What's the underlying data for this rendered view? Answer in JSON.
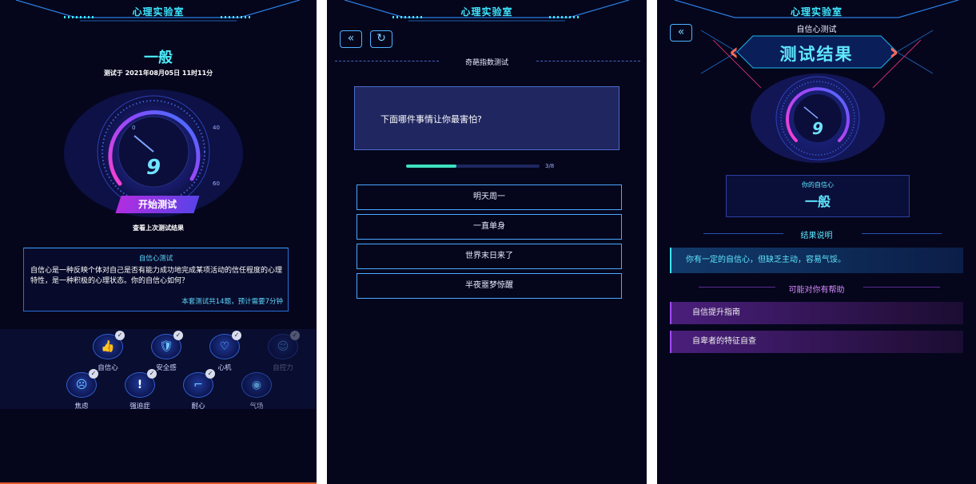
{
  "header": {
    "title": "心理实验室"
  },
  "home": {
    "level": "一般",
    "test_time": "测试于 2021年08月05日 11时11分",
    "gauge_value": "9",
    "start_button": "开始测试",
    "view_last": "查看上次测试结果",
    "desc_title": "自信心测试",
    "desc_text": "自信心是一种反映个体对自己是否有能力成功地完成某项活动的信任程度的心理特性，是一种积极的心理状态。你的自信心如何？",
    "desc_meta": "本套测试共14题，预计需要7分钟",
    "categories_row1": [
      {
        "label": "自信心",
        "icon": "thumbs-up-icon",
        "glyph": "👍",
        "checked": true
      },
      {
        "label": "安全感",
        "icon": "shield-icon",
        "glyph": "🛡",
        "checked": true
      },
      {
        "label": "心机",
        "icon": "heart-pulse-icon",
        "glyph": "♡",
        "checked": true
      },
      {
        "label": "自控力",
        "icon": "face-icon",
        "glyph": "☺",
        "checked": true
      }
    ],
    "categories_row2": [
      {
        "label": "焦虑",
        "icon": "anxious-face-icon",
        "glyph": "☹",
        "checked": true
      },
      {
        "label": "强迫症",
        "icon": "exclamation-icon",
        "glyph": "!",
        "checked": true
      },
      {
        "label": "耐心",
        "icon": "stairs-icon",
        "glyph": "⌐",
        "checked": true
      },
      {
        "label": "气场",
        "icon": "aura-icon",
        "glyph": "◉",
        "checked": false
      }
    ]
  },
  "quiz": {
    "title": "奇葩指数测试",
    "question": "下面哪件事情让你最害怕?",
    "progress_text": "3/8",
    "progress_fraction": 0.375,
    "options": [
      "明天周一",
      "一直单身",
      "世界末日来了",
      "半夜噩梦惊醒"
    ]
  },
  "result": {
    "test_name": "自信心测试",
    "banner": "测试结果",
    "gauge_value": "9",
    "your_label": "你的自信心",
    "your_value": "一般",
    "explain_title": "结果说明",
    "explain_text": "你有一定的自信心，但缺乏主动，容易气馁。",
    "help_title": "可能对你有帮助",
    "help_items": [
      "自信提升指南",
      "自卑者的特征自查"
    ]
  }
}
